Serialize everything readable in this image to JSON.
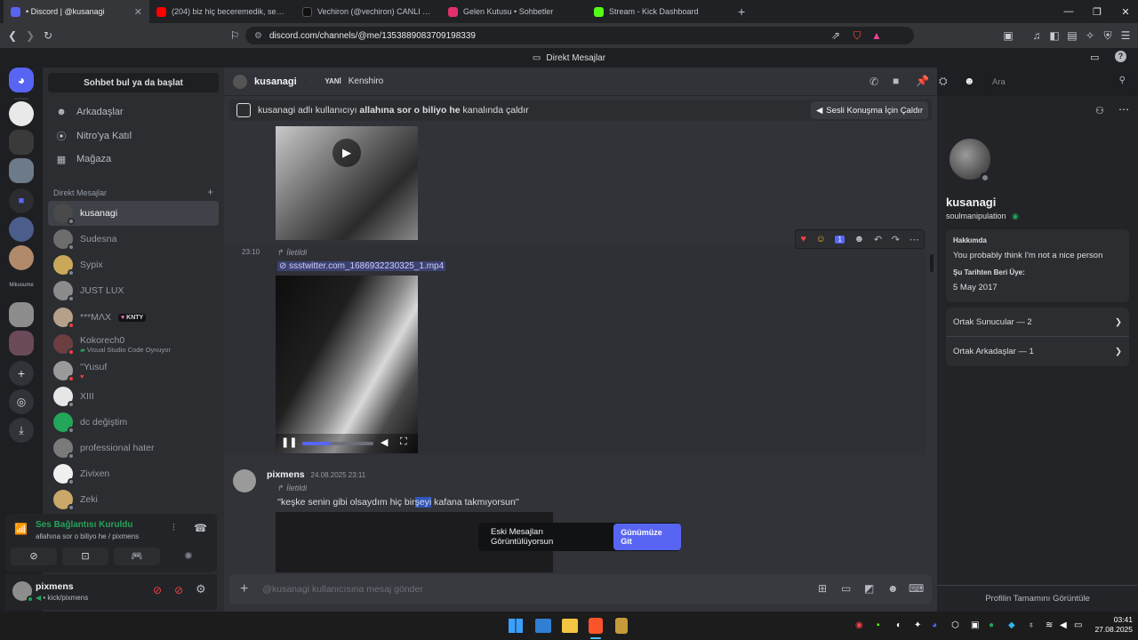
{
  "browser": {
    "tabs": [
      {
        "title": "• Discord | @kusanagi",
        "color": "#5865f2",
        "active": true
      },
      {
        "title": "(204) biz hiç beceremedik, sevmeyi d",
        "color": "#ff0000",
        "active": false
      },
      {
        "title": "Vechiron (@vechiron) CANLI Yayında",
        "color": "#111111",
        "active": false
      },
      {
        "title": "Gelen Kutusu • Sohbetler",
        "color": "#e1306c",
        "active": false
      },
      {
        "title": "Stream - Kick Dashboard",
        "color": "#53fc18",
        "active": false
      }
    ],
    "url": "discord.com/channels/@me/1353889083709198339"
  },
  "app": {
    "title": "Direkt Mesajlar"
  },
  "dm_sidebar": {
    "find_button": "Sohbet bul ya da başlat",
    "nav": [
      {
        "label": "Arkadaşlar",
        "icon": "friends-icon"
      },
      {
        "label": "Nitro'ya Katıl",
        "icon": "nitro-icon"
      },
      {
        "label": "Mağaza",
        "icon": "shop-icon"
      }
    ],
    "section_header": "Direkt Mesajlar",
    "add_symbol": "+",
    "dms": [
      {
        "name": "kusanagi",
        "sub": "",
        "status": "#80848e",
        "active": true
      },
      {
        "name": "Sudesna",
        "sub": "",
        "status": "#80848e",
        "active": false
      },
      {
        "name": "Sypix",
        "sub": "",
        "status": "#80848e",
        "active": false
      },
      {
        "name": "JUST LUX",
        "sub": "",
        "status": "#80848e",
        "active": false
      },
      {
        "name": "***MΛX",
        "sub": "",
        "status": "#f23f43",
        "active": false,
        "tag": "KNTY"
      },
      {
        "name": "Kokorech0",
        "sub": "Visual Studio Code Oynuyor",
        "status": "#f23f43",
        "active": false
      },
      {
        "name": "''Yusuf",
        "sub": "",
        "status": "#f23f43",
        "active": false
      },
      {
        "name": "XIII",
        "sub": "",
        "status": "#80848e",
        "active": false
      },
      {
        "name": "dc değiştim",
        "sub": "",
        "status": "#80848e",
        "active": false
      },
      {
        "name": "professional hater",
        "sub": "",
        "status": "#80848e",
        "active": false
      },
      {
        "name": "Zivixen",
        "sub": "",
        "status": "#80848e",
        "active": false
      },
      {
        "name": "Zeki",
        "sub": "",
        "status": "#80848e",
        "active": false
      }
    ],
    "voice": {
      "status": "Ses Bağlantısı Kuruldu",
      "channel": "allahına sor o biliyo he / pixmens"
    },
    "user": {
      "name": "pixmens",
      "sub": "• kick/pixmens"
    },
    "rail_label": "Mikusume"
  },
  "chat": {
    "header": {
      "name": "kusanagi",
      "also": "YANİ",
      "alias": "Kenshiro",
      "search_placeholder": "Ara"
    },
    "call_banner": {
      "pre": "kusanagi adlı kullanıcıyı",
      "channel": "allahına sor o biliyo he",
      "post": "kanalında çaldır",
      "button": "Sesli Konuşma İçin Çaldır"
    },
    "messages": [
      {
        "time": "23:10",
        "forwarded": "İletildi",
        "attachment": "ssstwitter.com_1686932230325_1.mp4"
      },
      {
        "author": "pixmens",
        "timestamp": "24.08.2025 23:11",
        "forwarded": "İletildi",
        "text_pre": "''keşke senin gibi olsaydım hiç bir",
        "text_sel": "şeyi",
        "text_post": " kafana takmıyorsun''"
      }
    ],
    "reaction_count": "1",
    "old_messages_notice": "Eski Mesajları Görüntülüyorsun",
    "jump_button": "Günümüze Git",
    "composer_placeholder": "@kusanagi kullanıcısına mesaj gönder"
  },
  "profile": {
    "name": "kusanagi",
    "username": "soulmanipulation",
    "about_label": "Hakkımda",
    "about_text": "You probably think I'm not a nice person",
    "since_label": "Şu Tarihten Beri Üye:",
    "since_value": "5 May 2017",
    "mutual_servers": "Ortak Sunucular — 2",
    "mutual_friends": "Ortak Arkadaşlar — 1",
    "full_profile": "Profilin Tamamını Görüntüle"
  },
  "taskbar": {
    "time": "03:41",
    "date": "27.08.2025"
  },
  "colors": {
    "accent": "#5865f2",
    "online_green": "#23a55a",
    "dnd_red": "#f23f43"
  }
}
